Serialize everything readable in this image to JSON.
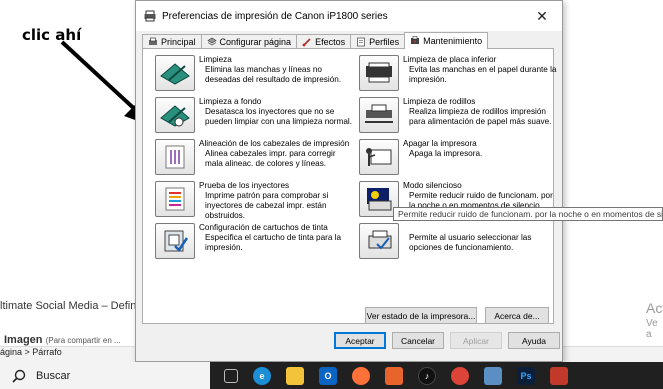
{
  "annotation": {
    "text": "clic ahí"
  },
  "background": {
    "line1": "ltimate Social Media – Definir",
    "line2_bold": "Imagen",
    "line2_small": "(Para compartir en ...",
    "breadcrumb": "ágina  >  Párrafo",
    "right1": "Act",
    "right2": "Ve a"
  },
  "dialog": {
    "title": "Preferencias de impresión de Canon iP1800 series",
    "tabs": [
      {
        "label": "Principal",
        "icon": "printer-icon"
      },
      {
        "label": "Configurar página",
        "icon": "layers-icon"
      },
      {
        "label": "Efectos",
        "icon": "brush-icon"
      },
      {
        "label": "Perfiles",
        "icon": "profile-icon"
      },
      {
        "label": "Mantenimiento",
        "icon": "maintenance-icon",
        "active": true
      }
    ],
    "left_items": [
      {
        "title": "Limpieza",
        "desc": "Elimina las manchas y líneas no deseadas del resultado de impresión."
      },
      {
        "title": "Limpieza a fondo",
        "desc": "Desatasca los inyectores que no se pueden limpiar con una limpieza normal."
      },
      {
        "title": "Alineación de los cabezales de impresión",
        "desc": "Alinea cabezales impr. para corregir mala alineac. de colores y líneas."
      },
      {
        "title": "Prueba de los inyectores",
        "desc": "Imprime patrón para comprobar si inyectores de cabezal impr. están obstruidos."
      },
      {
        "title": "Configuración de cartuchos de tinta",
        "desc": "Especifica el cartucho de tinta para la impresión."
      }
    ],
    "right_items": [
      {
        "title": "Limpieza de placa inferior",
        "desc": "Evita las manchas en el papel durante la impresión."
      },
      {
        "title": "Limpieza de rodillos",
        "desc": "Realiza limpieza de rodillos impresión para alimentación de papel más suave."
      },
      {
        "title": "Apagar la impresora",
        "desc": "Apaga la impresora."
      },
      {
        "title": "Modo silencioso",
        "desc": "Permite reducir ruido de funcionam. por la noche o en momentos de silencio."
      },
      {
        "title": "",
        "desc": "Permite al usuario seleccionar las opciones de funcionamiento."
      }
    ],
    "tooltip": "Permite reducir ruido de funcionam. por la noche o en momentos de silencio.",
    "status_button": "Ver estado de la impresora...",
    "about_button": "Acerca de...",
    "ok_button": "Aceptar",
    "cancel_button": "Cancelar",
    "apply_button": "Aplicar",
    "help_button": "Ayuda"
  },
  "taskbar": {
    "search_label": "Buscar",
    "apps": [
      "task-view-icon",
      "edge-icon",
      "file-explorer-icon",
      "outlook-icon",
      "firefox-icon",
      "photos-icon",
      "tiktok-icon",
      "chrome-icon",
      "snipping-icon",
      "photoshop-icon",
      "unknown-app-icon"
    ]
  }
}
